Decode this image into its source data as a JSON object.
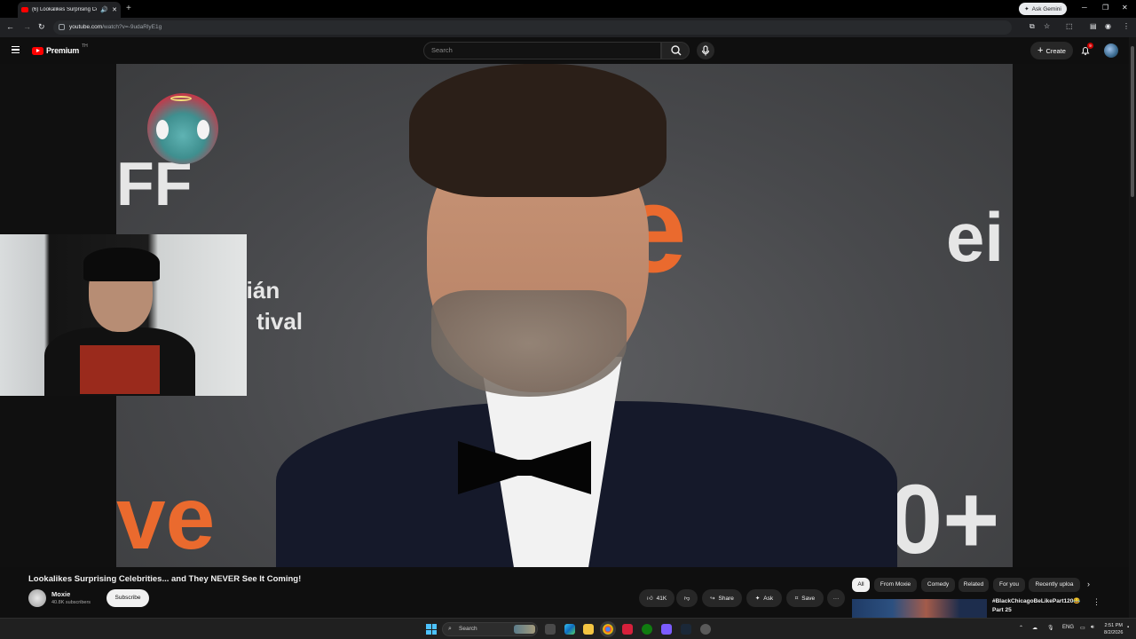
{
  "browser": {
    "tab_title": "(6) Lookalikes Surprising Ce",
    "url_host": "youtube.com",
    "url_path": "/watch?v=-9udaRlyE1g",
    "gemini_label": "Ask Gemini",
    "new_tab_label": "+"
  },
  "youtube": {
    "logo_word": "Premium",
    "country_code": "TH",
    "search_placeholder": "Search",
    "create_label": "Create",
    "notification_count": "9"
  },
  "video": {
    "title": "Lookalikes Surprising Celebrities... and They NEVER See It Coming!",
    "background_text": {
      "ff": "FF",
      "e": "e",
      "eit": "ei",
      "tian": "tián",
      "tival": "tival",
      "ve": "ve",
      "plus": "0+"
    }
  },
  "channel": {
    "name": "Moxie",
    "subscribers": "40.8K subscribers",
    "subscribe_label": "Subscribe"
  },
  "actions": {
    "likes": "41K",
    "share": "Share",
    "ask": "Ask",
    "save": "Save",
    "more": "···"
  },
  "filter_chips": [
    {
      "label": "All",
      "active": true
    },
    {
      "label": "From Moxie",
      "active": false
    },
    {
      "label": "Comedy",
      "active": false
    },
    {
      "label": "Related",
      "active": false
    },
    {
      "label": "For you",
      "active": false
    },
    {
      "label": "Recently uploa",
      "active": false
    }
  ],
  "recommendation": {
    "title_line1": "#BlackChicagoBeLikePart120😂",
    "title_line2": "Part 25"
  },
  "taskbar": {
    "search_placeholder": "Search",
    "language": "ENG",
    "time": "2:51 PM",
    "date": "8/2/2026"
  },
  "colors": {
    "youtube_red": "#ff0000",
    "background": "#0f0f0f",
    "accent_orange": "#ea6a2e"
  }
}
